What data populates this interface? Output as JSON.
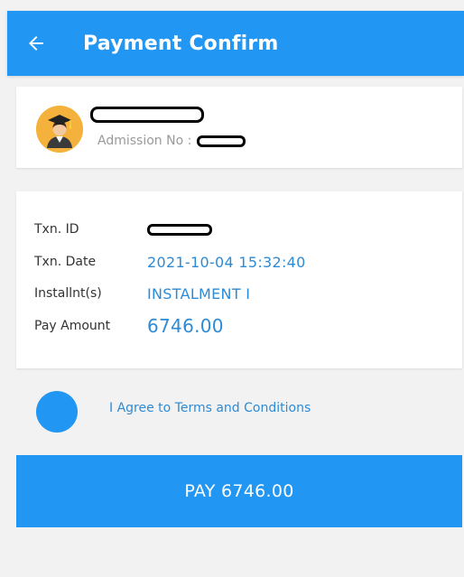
{
  "header": {
    "title": "Payment Confirm",
    "back_icon": "arrow-left-icon"
  },
  "profile": {
    "avatar_icon": "graduate-avatar-icon",
    "admission_label": "Admission No :"
  },
  "details": {
    "txn_id_label": "Txn. ID",
    "txn_date_label": "Txn. Date",
    "txn_date_value": "2021-10-04 15:32:40",
    "installment_label": "Installnt(s)",
    "installment_value": "INSTALMENT I",
    "pay_amount_label": "Pay Amount",
    "pay_amount_value": "6746.00"
  },
  "terms": {
    "label": "I Agree to Terms and Conditions"
  },
  "pay_button": {
    "label": "PAY 6746.00"
  },
  "colors": {
    "primary": "#2196f3",
    "accent_text": "#2d8bd6",
    "avatar_bg": "#f4b13b"
  }
}
